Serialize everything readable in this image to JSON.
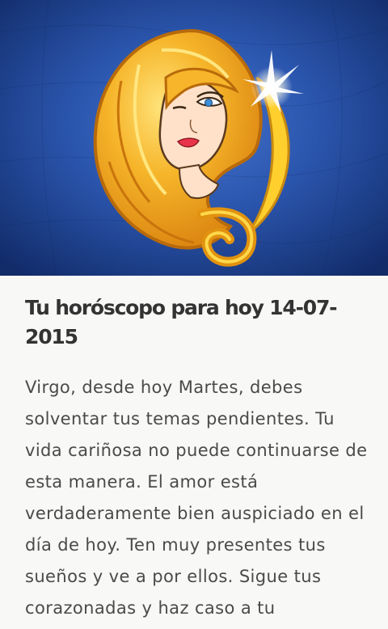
{
  "hero": {
    "image_name": "virgo-zodiac-illustration",
    "colors": {
      "background": "#2a55ad",
      "hair": "#f2a81f",
      "hair_highlight": "#ffd84a",
      "moon": "#ffcf2e",
      "skin": "#ffe1c9",
      "sparkle": "#ffffff"
    }
  },
  "article": {
    "title": "Tu horóscopo para hoy 14-07-2015",
    "body": "Virgo, desde hoy Martes, debes solventar tus temas pendientes. Tu vida cariñosa no puede continuarse de esta manera. El amor está verdaderamente bien auspiciado en el día de hoy. Ten muy presentes tus sueños y ve a por ellos. Sigue tus corazonadas y haz caso a tu"
  }
}
